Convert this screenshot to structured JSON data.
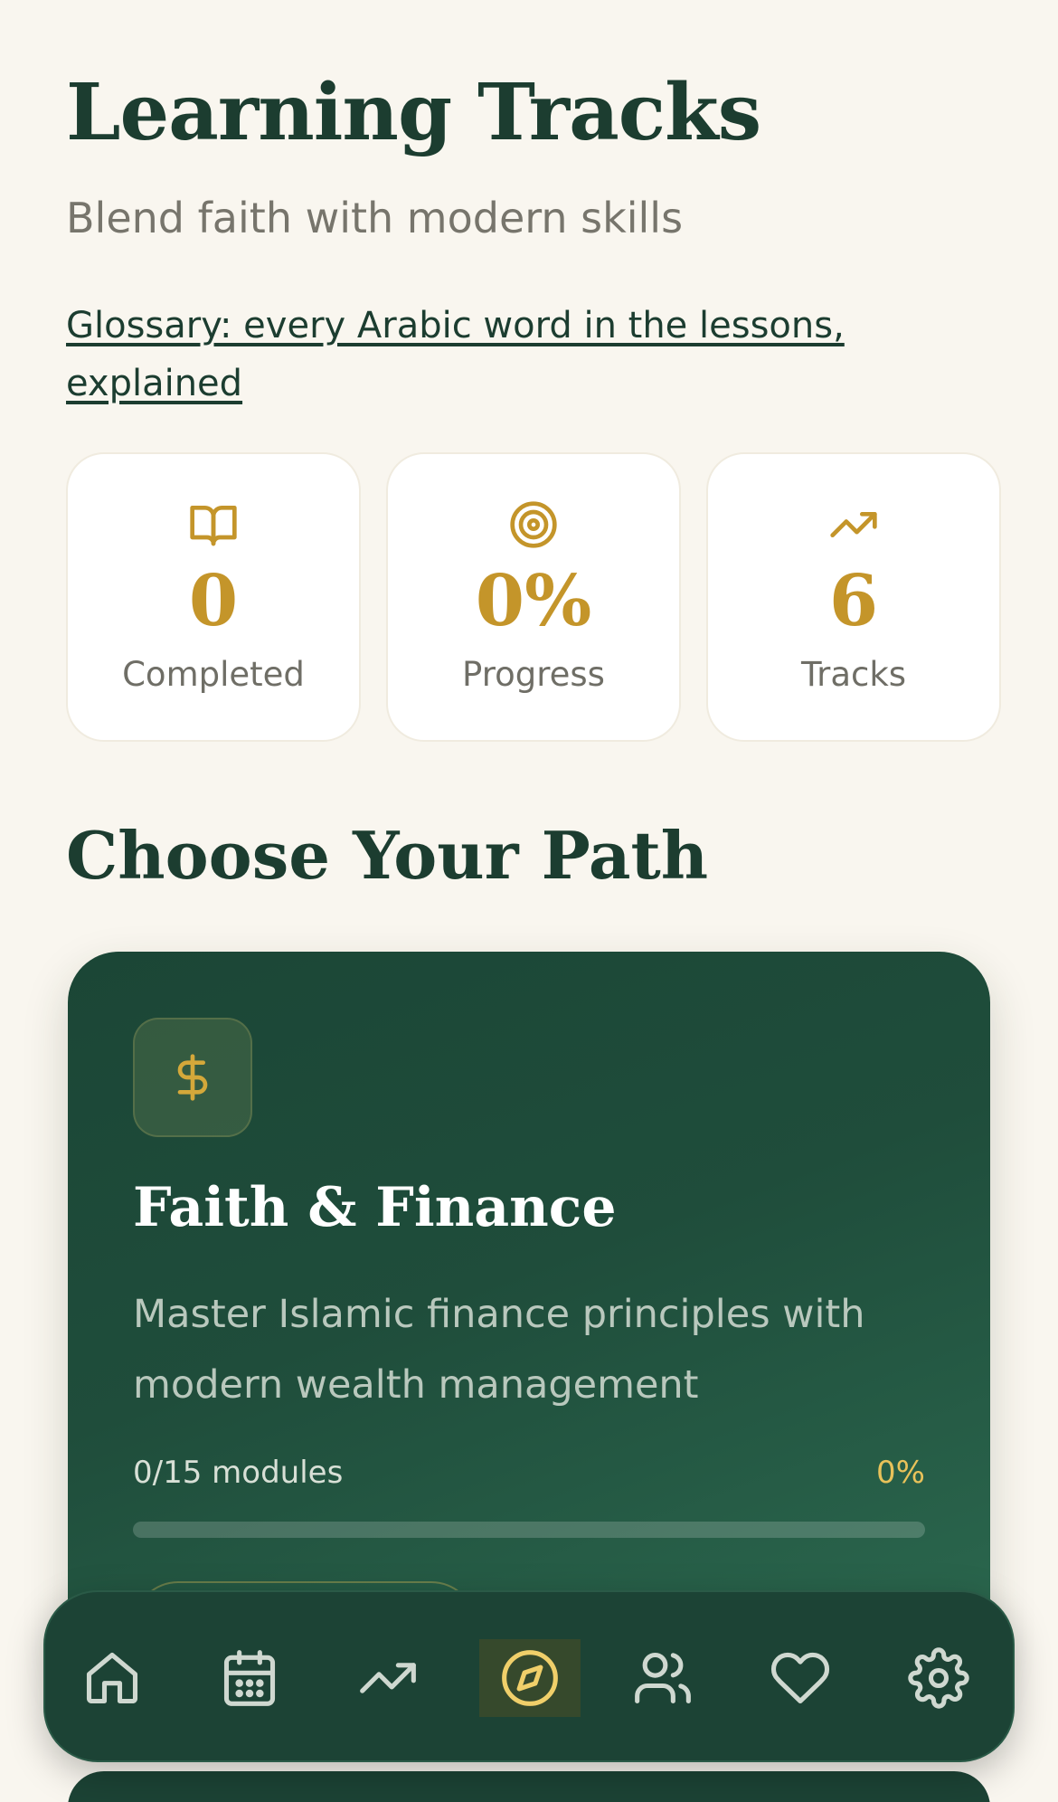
{
  "header": {
    "title": "Learning Tracks",
    "subtitle": "Blend faith with modern skills",
    "glossary_link": "Glossary: every Arabic word in the lessons, explained"
  },
  "stats": [
    {
      "icon": "book-open-icon",
      "value": "0",
      "label": "Completed"
    },
    {
      "icon": "target-icon",
      "value": "0%",
      "label": "Progress"
    },
    {
      "icon": "trending-up-icon",
      "value": "6",
      "label": "Tracks"
    }
  ],
  "section_title": "Choose Your Path",
  "tracks": [
    {
      "icon": "dollar-icon",
      "title": "Faith & Finance",
      "description": "Master Islamic finance principles with modern wealth management",
      "modules": "0/15 modules",
      "percent": "0%",
      "progress": 0
    }
  ],
  "nav": {
    "items": [
      {
        "icon": "home-icon",
        "active": false
      },
      {
        "icon": "calendar-icon",
        "active": false
      },
      {
        "icon": "trending-up-icon",
        "active": false
      },
      {
        "icon": "compass-icon",
        "active": true
      },
      {
        "icon": "users-icon",
        "active": false
      },
      {
        "icon": "heart-icon",
        "active": false
      },
      {
        "icon": "settings-icon",
        "active": false
      }
    ]
  },
  "colors": {
    "background": "#f9f6ef",
    "primary_green": "#1c3d30",
    "accent_gold": "#c4952a",
    "nav_background": "#1c4335"
  }
}
